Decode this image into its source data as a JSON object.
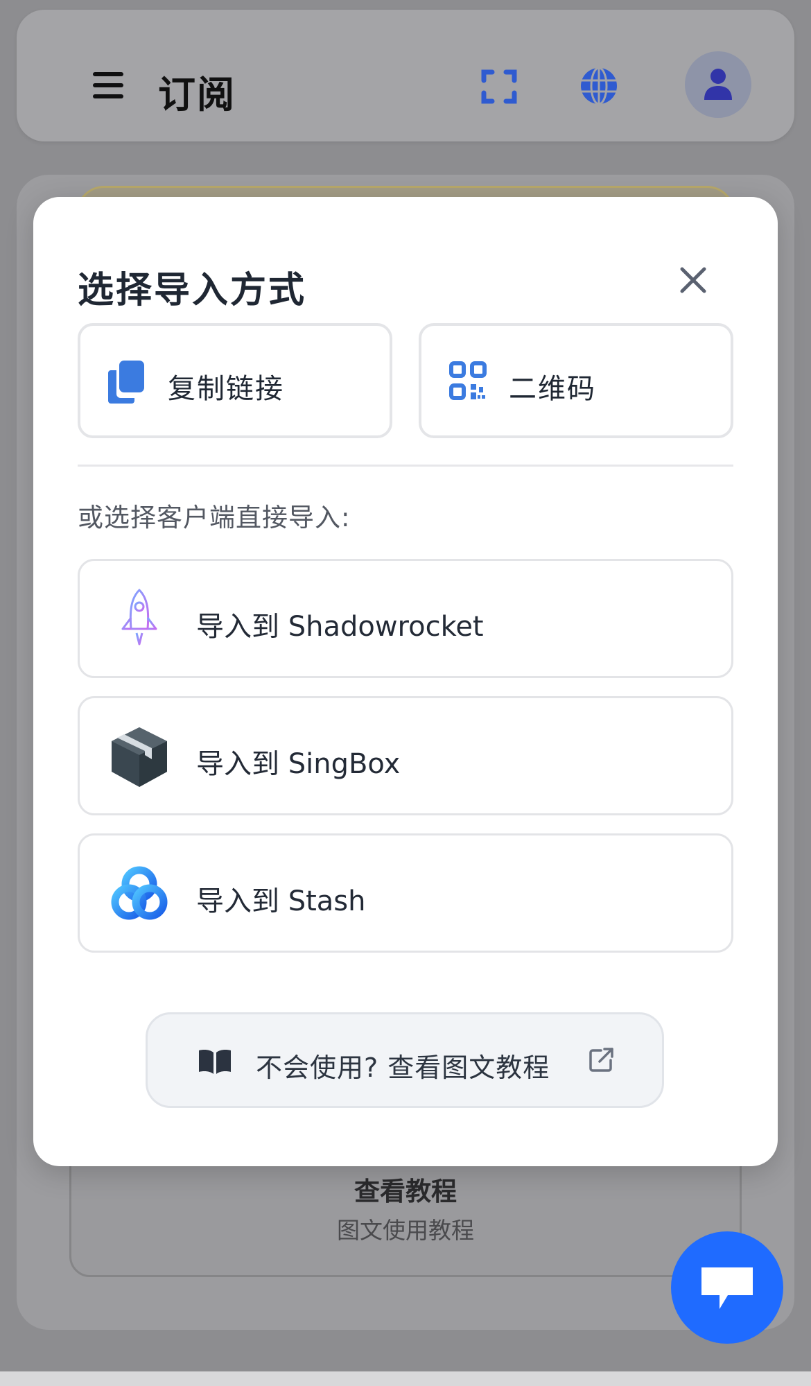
{
  "header": {
    "title": "订阅",
    "icons": [
      "menu-icon",
      "scan-icon",
      "globe-icon",
      "user-icon"
    ]
  },
  "background": {
    "tutorial_card": {
      "title": "查看教程",
      "subtitle": "图文使用教程"
    }
  },
  "modal": {
    "title": "选择导入方式",
    "actions": [
      {
        "label": "复制链接",
        "icon": "copy-icon"
      },
      {
        "label": "二维码",
        "icon": "qr-code-icon"
      }
    ],
    "client_prompt": "或选择客户端直接导入:",
    "clients": [
      {
        "label": "导入到 Shadowrocket",
        "icon": "shadowrocket-icon"
      },
      {
        "label": "导入到 SingBox",
        "icon": "singbox-icon"
      },
      {
        "label": "导入到 Stash",
        "icon": "stash-icon"
      }
    ],
    "tutorial_button": {
      "label": "不会使用? 查看图文教程",
      "icon": "book-icon",
      "trailing_icon": "external-link-icon"
    }
  },
  "colors": {
    "accent_blue": "#1f6bff",
    "icon_blue": "#3b7be0",
    "header_icon_blue": "#2f5bd0",
    "overlay": "#8d8d90"
  }
}
